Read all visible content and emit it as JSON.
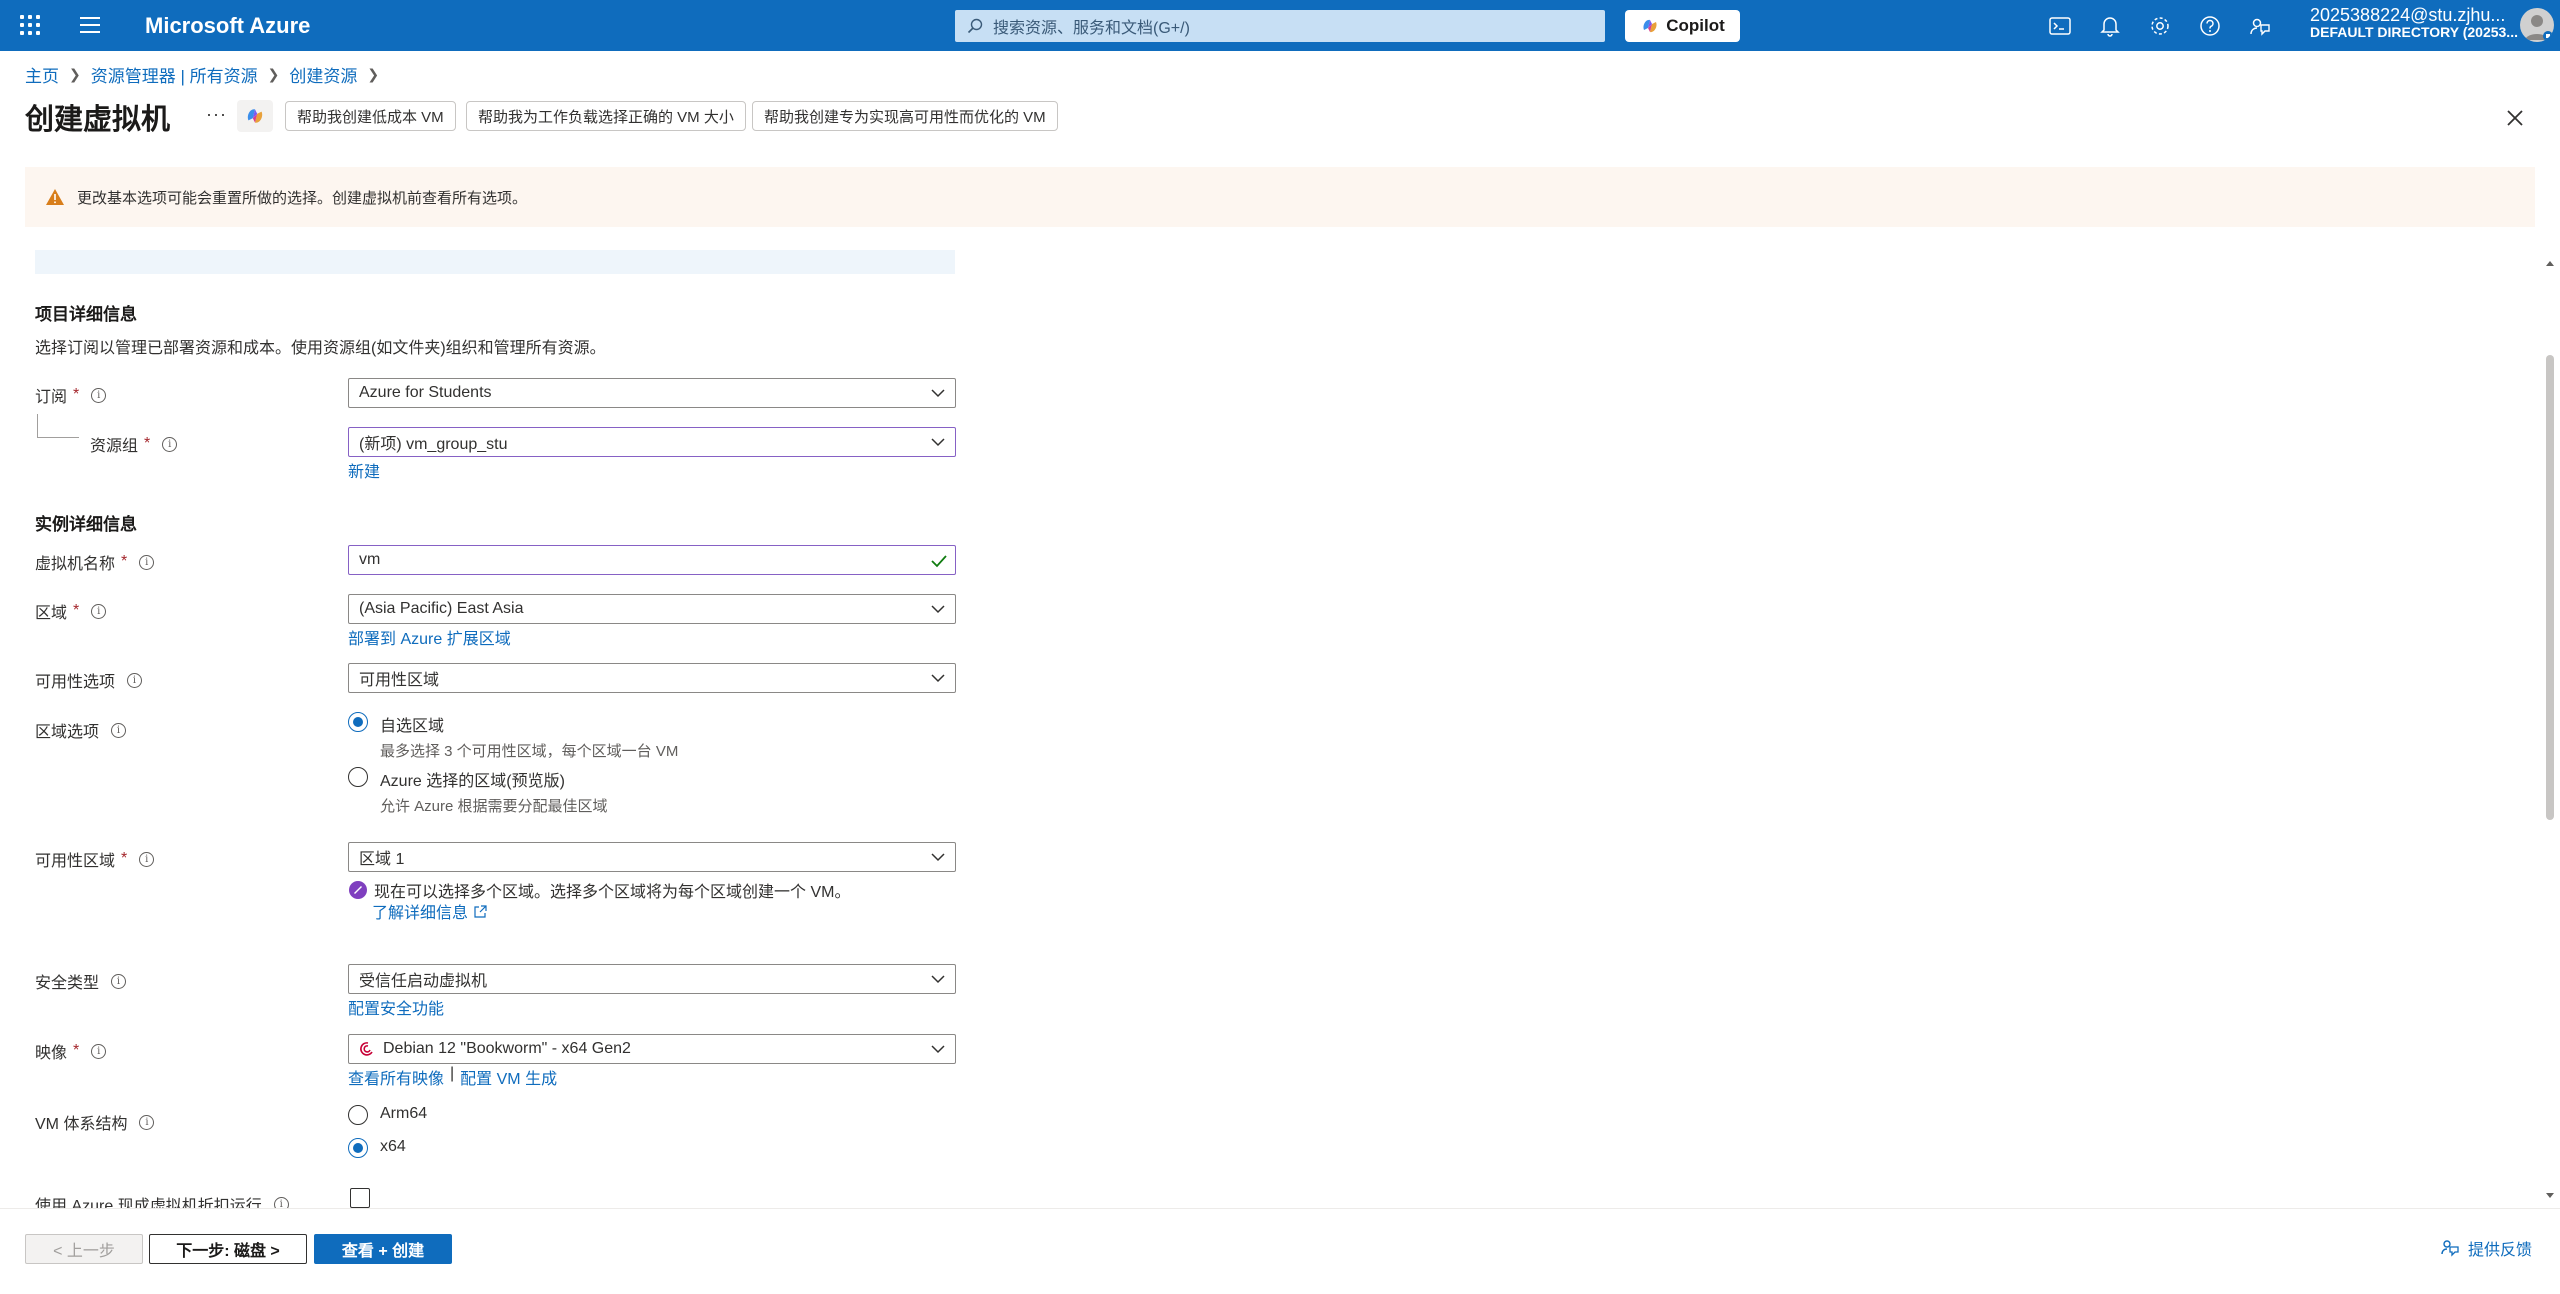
{
  "topbar": {
    "brand": "Microsoft Azure",
    "search_placeholder": "搜索资源、服务和文档(G+/)",
    "copilot_label": "Copilot",
    "account_user": "2025388224@stu.zjhu...",
    "account_directory": "DEFAULT DIRECTORY (20253...",
    "icons": [
      "waffle-icon",
      "hamburger-icon",
      "cloud-shell-icon",
      "bell-icon",
      "gear-icon",
      "help-icon",
      "feedback-icon"
    ],
    "accent_color": "#0f6cbd"
  },
  "breadcrumb": {
    "home": "主页",
    "explorer": "资源管理器 | 所有资源",
    "create": "创建资源"
  },
  "page": {
    "title": "创建虚拟机",
    "more": "···",
    "chips": [
      "帮助我创建低成本 VM",
      "帮助我为工作负载选择正确的 VM 大小",
      "帮助我创建专为实现高可用性而优化的 VM"
    ]
  },
  "warning": {
    "text": "更改基本选项可能会重置所做的选择。创建虚拟机前查看所有选项。",
    "color": "#fdf6f0"
  },
  "project": {
    "title": "项目详细信息",
    "desc": "选择订阅以管理已部署资源和成本。使用资源组(如文件夹)组织和管理所有资源。",
    "subscription_label": "订阅",
    "subscription_value": "Azure for Students",
    "resource_group_label": "资源组",
    "resource_group_value": "(新项) vm_group_stu",
    "new_link": "新建"
  },
  "instance": {
    "title": "实例详细信息",
    "vm_name_label": "虚拟机名称",
    "vm_name_value": "vm",
    "region_label": "区域",
    "region_value": "(Asia Pacific) East Asia",
    "region_link": "部署到 Azure 扩展区域",
    "availability_label": "可用性选项",
    "availability_value": "可用性区域",
    "zone_option_label": "区域选项",
    "zone_opt1_title": "自选区域",
    "zone_opt1_sub": "最多选择 3 个可用性区域，每个区域一台 VM",
    "zone_opt2_title": "Azure 选择的区域(预览版)",
    "zone_opt2_sub": "允许 Azure 根据需要分配最佳区域",
    "zone_label": "可用性区域",
    "zone_value": "区域 1",
    "zone_note": "现在可以选择多个区域。选择多个区域将为每个区域创建一个 VM。",
    "zone_learn_more": "了解详细信息",
    "security_label": "安全类型",
    "security_value": "受信任启动虚拟机",
    "security_link": "配置安全功能",
    "image_label": "映像",
    "image_value": "Debian 12 \"Bookworm\" - x64 Gen2",
    "image_link1": "查看所有映像",
    "image_link_sep": "|",
    "image_link2": "配置 VM 生成",
    "arch_label": "VM 体系结构",
    "arch_opt1": "Arm64",
    "arch_opt2": "x64",
    "spot_label": "使用 Azure 现成虚拟机折扣运行"
  },
  "footer": {
    "prev": "< 上一步",
    "next": "下一步: 磁盘 >",
    "review": "查看 + 创建",
    "feedback": "提供反馈"
  }
}
